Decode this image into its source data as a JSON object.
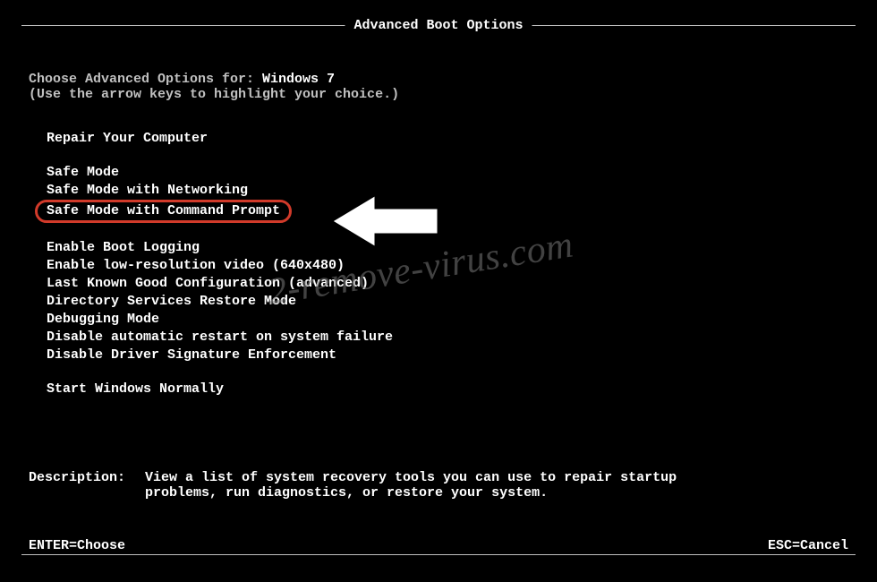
{
  "title": "Advanced Boot Options",
  "intro": {
    "prefix": "Choose Advanced Options for: ",
    "os": "Windows 7",
    "hint": "(Use the arrow keys to highlight your choice.)"
  },
  "groups": [
    {
      "items": [
        "Repair Your Computer"
      ]
    },
    {
      "items": [
        "Safe Mode",
        "Safe Mode with Networking",
        "Safe Mode with Command Prompt"
      ]
    },
    {
      "items": [
        "Enable Boot Logging",
        "Enable low-resolution video (640x480)",
        "Last Known Good Configuration (advanced)",
        "Directory Services Restore Mode",
        "Debugging Mode",
        "Disable automatic restart on system failure",
        "Disable Driver Signature Enforcement"
      ]
    },
    {
      "items": [
        "Start Windows Normally"
      ]
    }
  ],
  "highlighted_item": "Safe Mode with Command Prompt",
  "description": {
    "label": "Description:",
    "text": "View a list of system recovery tools you can use to repair startup problems, run diagnostics, or restore your system."
  },
  "footer": {
    "enter": "ENTER=Choose",
    "esc": "ESC=Cancel"
  },
  "watermark": "2-remove-virus.com"
}
